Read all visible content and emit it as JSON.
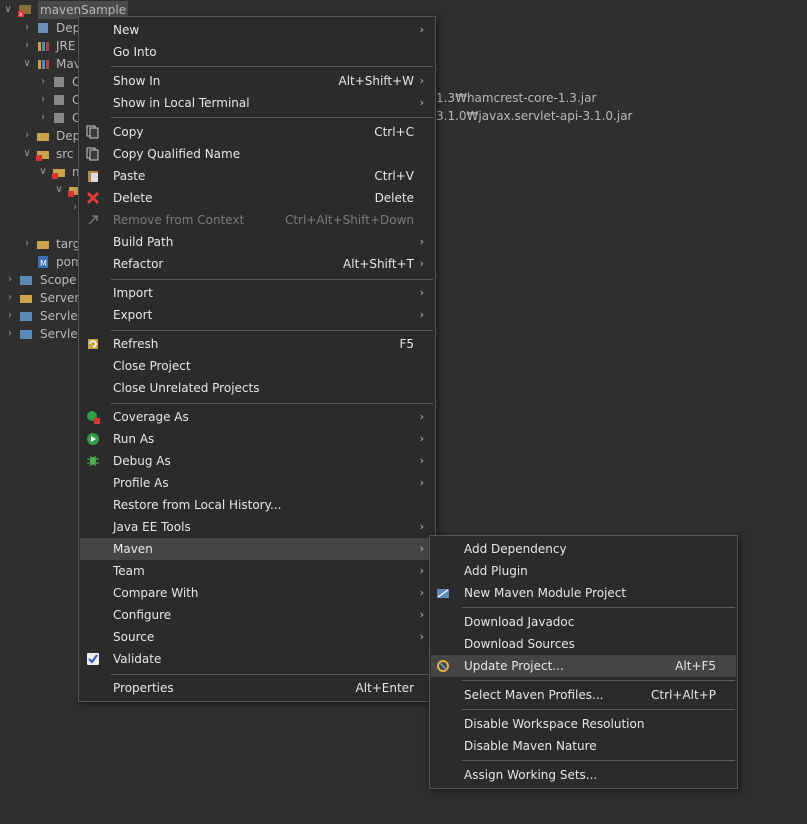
{
  "tree": {
    "root_label": "mavenSample",
    "rows": [
      {
        "label": "Dep"
      },
      {
        "label": "JRE"
      },
      {
        "label": "Mav"
      },
      {
        "label": "C"
      },
      {
        "label": "C"
      },
      {
        "label": "C"
      },
      {
        "label": "Dep"
      },
      {
        "label": "src"
      },
      {
        "label": "m"
      },
      {
        "label": ""
      },
      {
        "label": ""
      },
      {
        "label": "targ"
      },
      {
        "label": "pom"
      },
      {
        "label": "Scope"
      },
      {
        "label": "Servers"
      },
      {
        "label": "Servlet"
      },
      {
        "label": "Servlet"
      }
    ],
    "jar_path_1": "1.3₩hamcrest-core-1.3.jar",
    "jar_path_2": "3.1.0₩javax.servlet-api-3.1.0.jar"
  },
  "context_menu": {
    "items": [
      {
        "label": "New",
        "shortcut": "",
        "submenu": true
      },
      {
        "label": "Go Into",
        "shortcut": ""
      },
      {
        "label": "Show In",
        "shortcut": "Alt+Shift+W",
        "submenu": true
      },
      {
        "label": "Show in Local Terminal",
        "shortcut": "",
        "submenu": true
      },
      {
        "label": "Copy",
        "shortcut": "Ctrl+C",
        "icon": "copy-icon"
      },
      {
        "label": "Copy Qualified Name",
        "shortcut": "",
        "icon": "copy-qualified-icon"
      },
      {
        "label": "Paste",
        "shortcut": "Ctrl+V",
        "icon": "paste-icon"
      },
      {
        "label": "Delete",
        "shortcut": "Delete",
        "icon": "delete-icon"
      },
      {
        "label": "Remove from Context",
        "shortcut": "Ctrl+Alt+Shift+Down",
        "disabled": true,
        "icon": "remove-context-icon"
      },
      {
        "label": "Build Path",
        "shortcut": "",
        "submenu": true
      },
      {
        "label": "Refactor",
        "shortcut": "Alt+Shift+T",
        "submenu": true
      },
      {
        "label": "Import",
        "shortcut": "",
        "submenu": true
      },
      {
        "label": "Export",
        "shortcut": "",
        "submenu": true
      },
      {
        "label": "Refresh",
        "shortcut": "F5",
        "icon": "refresh-icon"
      },
      {
        "label": "Close Project",
        "shortcut": ""
      },
      {
        "label": "Close Unrelated Projects",
        "shortcut": ""
      },
      {
        "label": "Coverage As",
        "shortcut": "",
        "submenu": true,
        "icon": "coverage-icon"
      },
      {
        "label": "Run As",
        "shortcut": "",
        "submenu": true,
        "icon": "run-icon"
      },
      {
        "label": "Debug As",
        "shortcut": "",
        "submenu": true,
        "icon": "debug-icon"
      },
      {
        "label": "Profile As",
        "shortcut": "",
        "submenu": true
      },
      {
        "label": "Restore from Local History...",
        "shortcut": ""
      },
      {
        "label": "Java EE Tools",
        "shortcut": "",
        "submenu": true
      },
      {
        "label": "Maven",
        "shortcut": "",
        "submenu": true,
        "highlighted": true
      },
      {
        "label": "Team",
        "shortcut": "",
        "submenu": true
      },
      {
        "label": "Compare With",
        "shortcut": "",
        "submenu": true
      },
      {
        "label": "Configure",
        "shortcut": "",
        "submenu": true
      },
      {
        "label": "Source",
        "shortcut": "",
        "submenu": true
      },
      {
        "label": "Validate",
        "shortcut": "",
        "icon": "checkbox-icon"
      },
      {
        "label": "Properties",
        "shortcut": "Alt+Enter"
      }
    ]
  },
  "maven_submenu": {
    "items": [
      {
        "label": "Add Dependency",
        "shortcut": ""
      },
      {
        "label": "Add Plugin",
        "shortcut": ""
      },
      {
        "label": "New Maven Module Project",
        "shortcut": "",
        "icon": "maven-module-icon"
      },
      {
        "label": "Download Javadoc",
        "shortcut": ""
      },
      {
        "label": "Download Sources",
        "shortcut": ""
      },
      {
        "label": "Update Project...",
        "shortcut": "Alt+F5",
        "icon": "update-project-icon",
        "highlighted": true
      },
      {
        "label": "Select Maven Profiles...",
        "shortcut": "Ctrl+Alt+P"
      },
      {
        "label": "Disable Workspace Resolution",
        "shortcut": ""
      },
      {
        "label": "Disable Maven Nature",
        "shortcut": ""
      },
      {
        "label": "Assign Working Sets...",
        "shortcut": ""
      }
    ]
  }
}
